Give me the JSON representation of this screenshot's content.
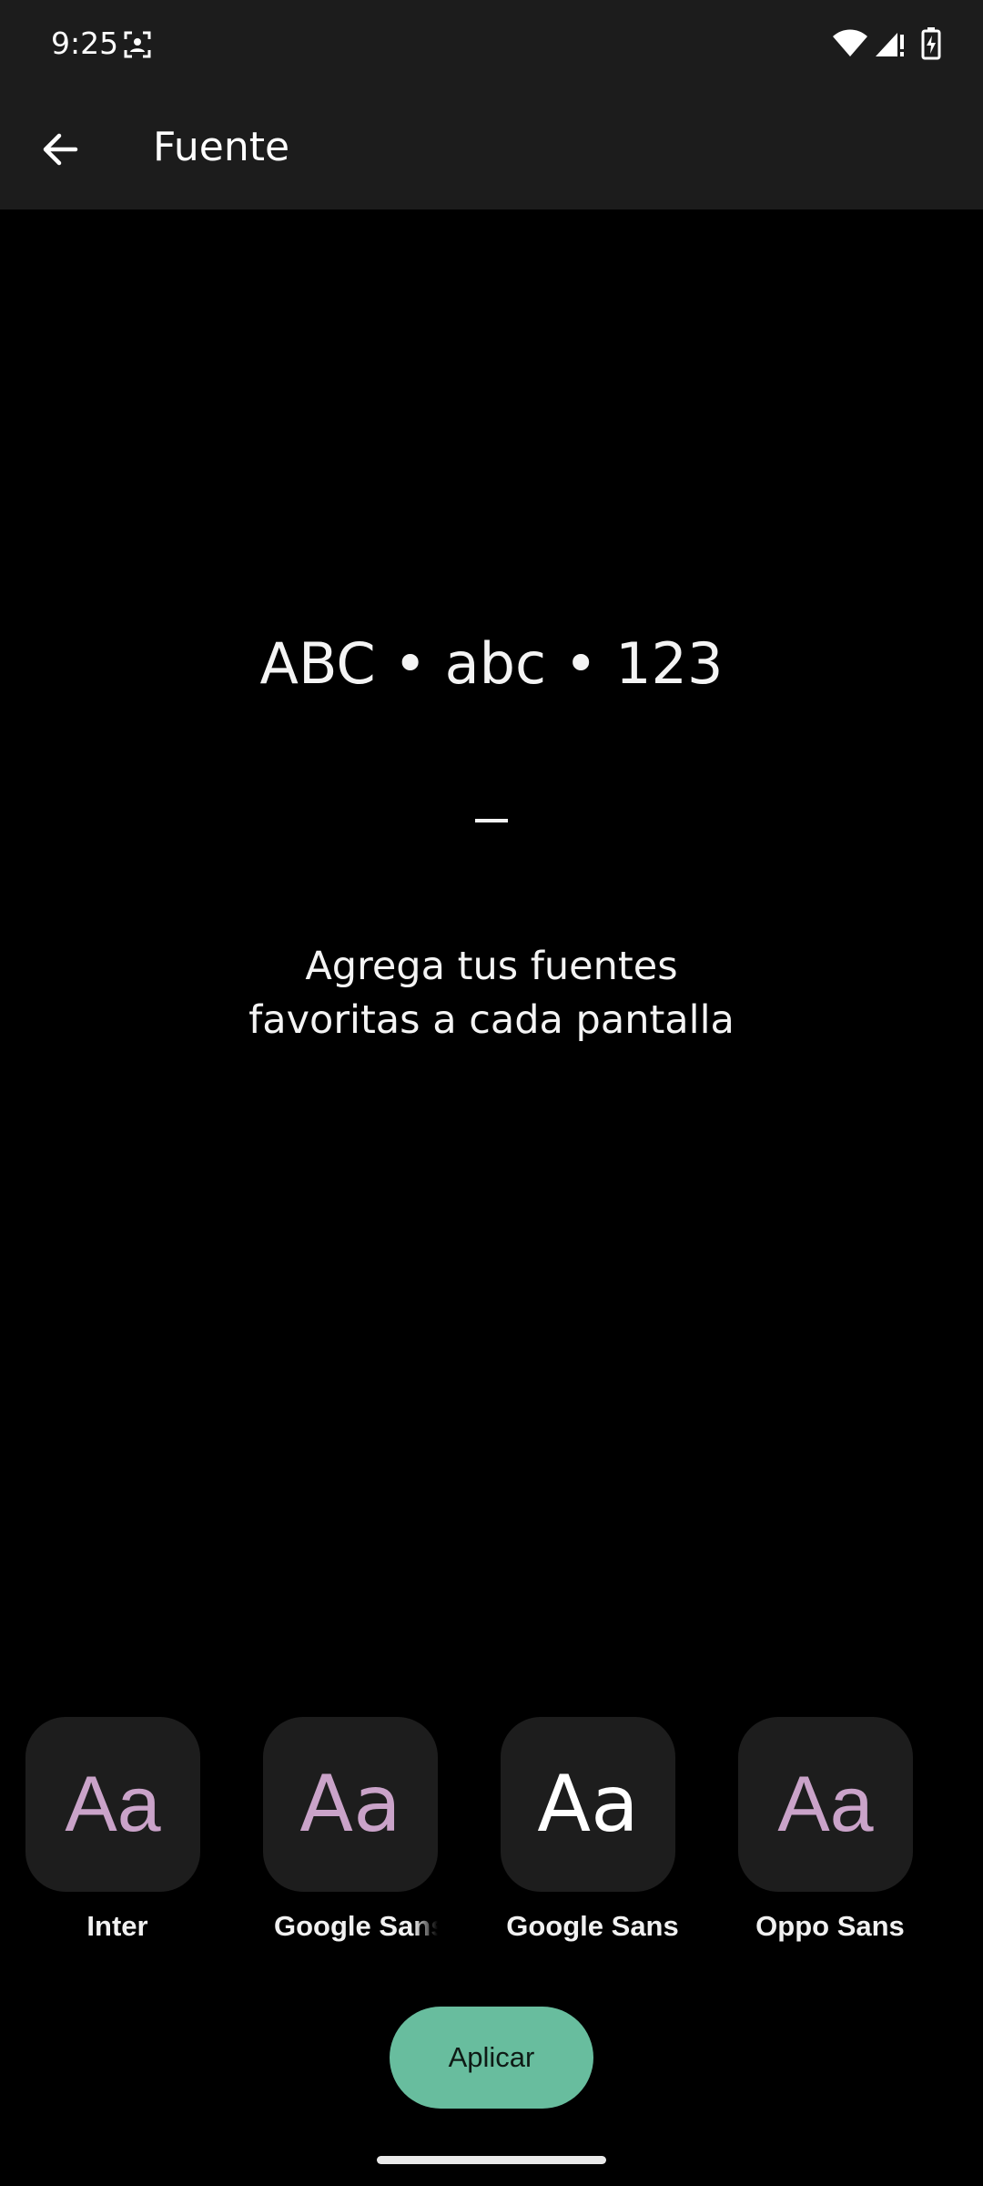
{
  "status_bar": {
    "time": "9:25",
    "icons": [
      "screenshot-icon",
      "wifi-icon",
      "signal-icon",
      "battery-charging-icon"
    ]
  },
  "app_bar": {
    "title": "Fuente",
    "back_icon": "arrow-back-icon"
  },
  "preview": {
    "sample": "ABC • abc • 123",
    "caption_line1": "Agrega tus fuentes",
    "caption_line2": "favoritas a cada pantalla"
  },
  "font_options": [
    {
      "glyph": "Aa",
      "label": "Inter",
      "selected": false
    },
    {
      "glyph": "Aa",
      "label": "Google Sans",
      "selected": false
    },
    {
      "glyph": "Aa",
      "label": "Google Sans",
      "selected": true
    },
    {
      "glyph": "Aa",
      "label": "Oppo Sans",
      "selected": false
    }
  ],
  "apply_button": {
    "label": "Aplicar"
  },
  "colors": {
    "bar_background": "#1c1c1c",
    "tile_background": "#1d1d1d",
    "tile_glyph": "#caa3c9",
    "tile_glyph_selected": "#ffffff",
    "accent": "#68bd9e"
  }
}
